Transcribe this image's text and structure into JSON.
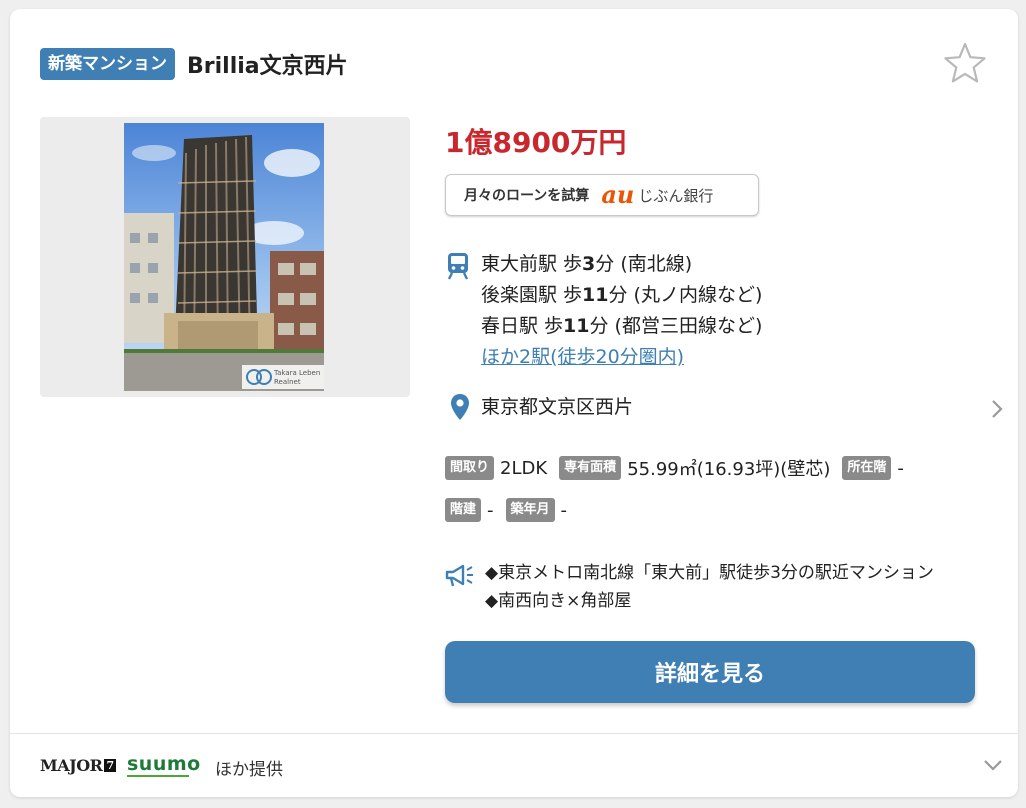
{
  "colors": {
    "accent": "#3f7fb3",
    "price": "#c8282d",
    "tag_bg": "#8a8a8a",
    "au_orange": "#eb5505"
  },
  "header": {
    "badge": "新築マンション",
    "title": "Brillia文京西片",
    "favorite_icon": "star-outline-icon"
  },
  "photo": {
    "credit_line1": "Takara Leben",
    "credit_line2": "Realnet"
  },
  "price": "1億8900万円",
  "loan": {
    "label": "月々のローンを試算",
    "brand_logo": "au",
    "bank": "じぶん銀行"
  },
  "access": {
    "icon": "train-icon",
    "stations": [
      {
        "name": "東大前駅 歩",
        "minutes": "3",
        "suffix": "分 (南北線)"
      },
      {
        "name": "後楽園駅 歩",
        "minutes": "11",
        "suffix": "分 (丸ノ内線など)"
      },
      {
        "name": "春日駅 歩",
        "minutes": "11",
        "suffix": "分 (都営三田線など)"
      }
    ],
    "more_link": "ほか2駅(徒歩20分圏内)"
  },
  "address": {
    "icon": "map-pin-icon",
    "text": "東京都文京区西片"
  },
  "specs": {
    "madori_label": "間取り",
    "madori_value": "2LDK",
    "area_label": "専有面積",
    "area_value": "55.99㎡(16.93坪)(壁芯)",
    "floor_label": "所在階",
    "floor_value": "-",
    "levels_label": "階建",
    "levels_value": "-",
    "built_label": "築年月",
    "built_value": "-"
  },
  "pr": {
    "icon": "megaphone-icon",
    "line1": "◆東京メトロ南北線「東大前」駅徒歩3分の駅近マンション",
    "line2": "◆南西向き×角部屋"
  },
  "detail_button": "詳細を見る",
  "footer": {
    "major": "MAJOR",
    "major_badge": "7",
    "suumo": "suumo",
    "other": "ほか提供"
  }
}
